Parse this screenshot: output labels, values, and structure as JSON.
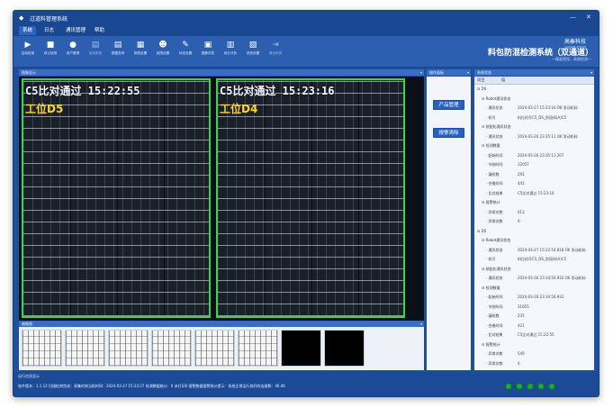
{
  "window": {
    "title": "过道料管理系统",
    "minimize": "—",
    "close": "✕"
  },
  "menu": [
    "系统",
    "日志",
    "通讯管理",
    "帮助"
  ],
  "toolbar": [
    {
      "icon": "play-icon",
      "glyph": "▶",
      "label": "启动检测",
      "dim": false
    },
    {
      "icon": "stop-icon",
      "glyph": "■",
      "label": "停止检测",
      "dim": false
    },
    {
      "icon": "user-icon",
      "glyph": "●",
      "label": "用户管理",
      "dim": false
    },
    {
      "icon": "document-icon",
      "glyph": "▤",
      "label": "检测参数",
      "dim": true
    },
    {
      "icon": "document-icon",
      "glyph": "▤",
      "label": "数据查询",
      "dim": false
    },
    {
      "icon": "printer-icon",
      "glyph": "▦",
      "label": "报表设置",
      "dim": false
    },
    {
      "icon": "users-icon",
      "glyph": "☻",
      "label": "权限设置",
      "dim": false
    },
    {
      "icon": "tools-icon",
      "glyph": "✎",
      "label": "标定设置",
      "dim": false
    },
    {
      "icon": "image-icon",
      "glyph": "▣",
      "label": "图像浏览",
      "dim": false
    },
    {
      "icon": "calculator-icon",
      "glyph": "▥",
      "label": "统计分析",
      "dim": false
    },
    {
      "icon": "settings-icon",
      "glyph": "▧",
      "label": "系统设置",
      "dim": false
    },
    {
      "icon": "exit-icon",
      "glyph": "⇥",
      "label": "退出系统",
      "dim": true
    }
  ],
  "brand": {
    "name": "高秦科技",
    "sub": "GAOQIN VISION"
  },
  "system": {
    "name": "料包防混检测系统（双通道）",
    "subtitle": "一精准视觉，高效检测一"
  },
  "view_panel": {
    "title": "图像显示"
  },
  "cameras": [
    {
      "overlay": "C5比对通过 15:22:55",
      "station": "工位D5"
    },
    {
      "overlay": "C5比对通过 15:23:16",
      "station": "工位D4"
    }
  ],
  "thumbs_panel": {
    "title": "缩略图"
  },
  "thumbs": [
    {
      "dark": false
    },
    {
      "dark": false
    },
    {
      "dark": false
    },
    {
      "dark": false
    },
    {
      "dark": false
    },
    {
      "dark": false
    },
    {
      "dark": true
    },
    {
      "dark": true
    }
  ],
  "ops_panel": {
    "title": "操作面板",
    "product_btn": "产品管理",
    "clear_btn": "报警清除"
  },
  "data_panel": {
    "title": "系统状态",
    "col_item": "项目",
    "col_value": "值"
  },
  "tree": [
    {
      "level": 0,
      "k": "⊟ D4",
      "v": ""
    },
    {
      "level": 1,
      "k": "⊟ Robot通讯状态",
      "v": ""
    },
    {
      "level": 2,
      "k": "· 通讯状态",
      "v": "2024-03-27 15:23:16 OK 发动机料"
    },
    {
      "level": 2,
      "k": "· 机号",
      "v": "料位机号C5_DS_阶段(料A)C5"
    },
    {
      "level": 1,
      "k": "⊟ 装配化通讯状态",
      "v": ""
    },
    {
      "level": 2,
      "k": "· 通讯状态",
      "v": "2024-03-26 23:35:11 OK 发动机料"
    },
    {
      "level": 1,
      "k": "⊟ 检测数量",
      "v": ""
    },
    {
      "level": 2,
      "k": "· 起始时间",
      "v": "2024-03-26 23:35:11.207"
    },
    {
      "level": 2,
      "k": "· 节拍时间",
      "v": "32057"
    },
    {
      "level": 2,
      "k": "· 漏检数",
      "v": "291"
    },
    {
      "level": 2,
      "k": "· 合格时间",
      "v": "441"
    },
    {
      "level": 2,
      "k": "· 比对结果",
      "v": "C5比对通过 15:23:16"
    },
    {
      "level": 1,
      "k": "⊟ 报警统计",
      "v": ""
    },
    {
      "level": 2,
      "k": "· 异常次数",
      "v": "613"
    },
    {
      "level": 2,
      "k": "· 异常次数",
      "v": "0"
    },
    {
      "level": 0,
      "k": "⊟ D5",
      "v": ""
    },
    {
      "level": 1,
      "k": "⊟ Robot通讯状态",
      "v": ""
    },
    {
      "level": 2,
      "k": "· 通讯状态",
      "v": "2024-03-27 15:22:54.818 OK 发动机料"
    },
    {
      "level": 2,
      "k": "· 机号",
      "v": "料位机号C5_DS_阶段(料A)C5"
    },
    {
      "level": 1,
      "k": "⊟ 装配化通讯状态",
      "v": ""
    },
    {
      "level": 2,
      "k": "· 通讯状态",
      "v": "2024-03-26 23:34:56.932 OK 发动机料"
    },
    {
      "level": 1,
      "k": "⊟ 检测数量",
      "v": ""
    },
    {
      "level": 2,
      "k": "· 起始时间",
      "v": "2024-03-26 23:34:56.932"
    },
    {
      "level": 2,
      "k": "· 节拍时间",
      "v": "31655"
    },
    {
      "level": 2,
      "k": "· 漏检数",
      "v": "235"
    },
    {
      "level": 2,
      "k": "· 合格时间",
      "v": "421"
    },
    {
      "level": 2,
      "k": "· 比对结果",
      "v": "C5比对通过 15:22:55"
    },
    {
      "level": 1,
      "k": "⊟ 报警统计",
      "v": ""
    },
    {
      "level": 2,
      "k": "· 异常次数",
      "v": "549"
    },
    {
      "level": 2,
      "k": "· 异常次数",
      "v": "0"
    }
  ],
  "status": {
    "panel_title": "运行信息显示",
    "text": "软件版本：1.1.12 扫描检测完成：采集时刻当前时间：2024-03-27 15:23:27 检测数据统计：0 未打印0 报警数据报警统计提示：系统正常运行良好的连接数：46.46"
  },
  "lamps": 5,
  "colors": {
    "frame": "#1d4f9c",
    "toolbar": "#2d5fb0",
    "pass_border": "#3fd24a",
    "station_text": "#ffd52b",
    "lamp_ok": "#1fa53a"
  }
}
